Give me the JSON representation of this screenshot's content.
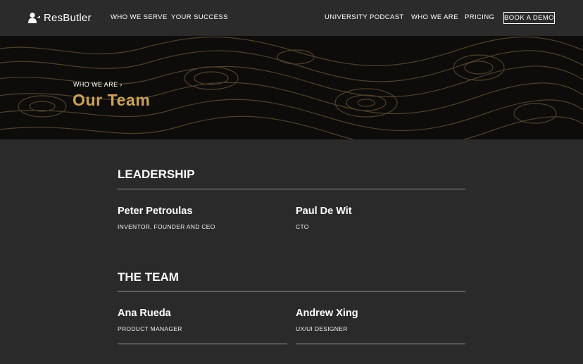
{
  "nav": {
    "brand": "ResButler",
    "left_links": [
      "WHO WE SERVE",
      "YOUR SUCCESS"
    ],
    "right_links": [
      "UNIVERSITY",
      "PODCAST",
      "WHO WE ARE",
      "PRICING"
    ],
    "cta": "BOOK A DEMO"
  },
  "hero": {
    "breadcrumb": "WHO WE ARE ›",
    "title": "Our Team",
    "accent_color": "#c9a25a"
  },
  "leadership": {
    "title": "LEADERSHIP",
    "people": [
      {
        "name": "Peter Petroulas",
        "role": "INVENTOR. FOUNDER AND CEO"
      },
      {
        "name": "Paul De Wit",
        "role": "CTO"
      }
    ]
  },
  "team": {
    "title": "THE TEAM",
    "people": [
      {
        "name": "Ana Rueda",
        "role": "PRODUCT MANAGER"
      },
      {
        "name": "Andrew Xing",
        "role": "UX/UI DESIGNER"
      }
    ]
  },
  "icons": {
    "logo": "butler-icon"
  }
}
